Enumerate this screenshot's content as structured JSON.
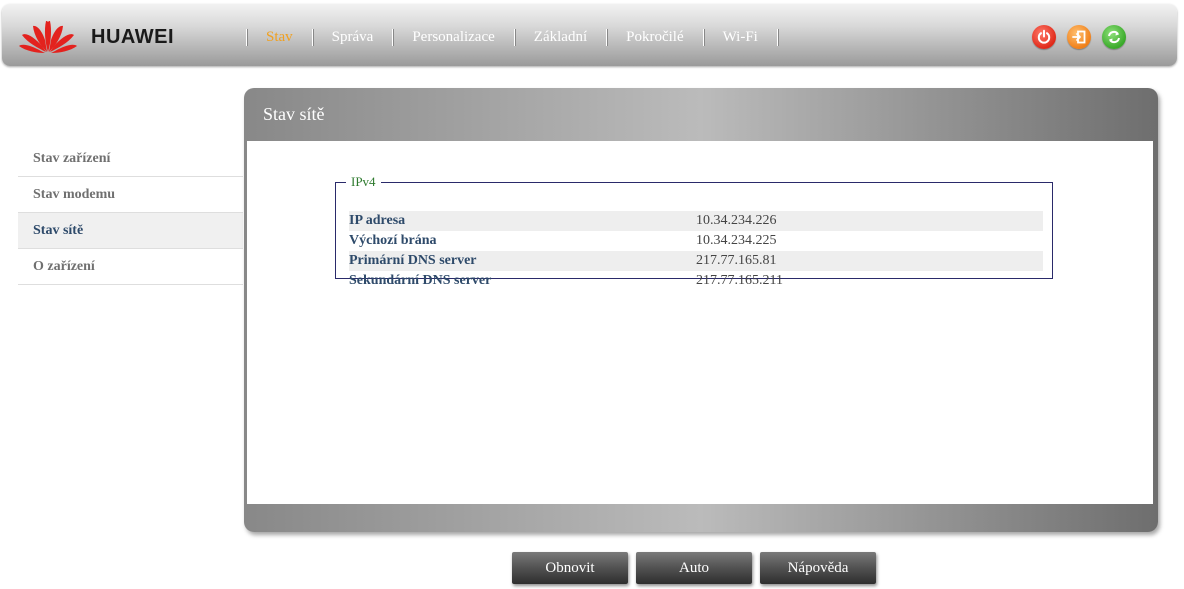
{
  "header": {
    "brand": "HUAWEI",
    "nav": [
      {
        "label": "Stav",
        "active": true
      },
      {
        "label": "Správa"
      },
      {
        "label": "Personalizace"
      },
      {
        "label": "Základní"
      },
      {
        "label": "Pokročilé"
      },
      {
        "label": "Wi-Fi"
      }
    ],
    "icons": [
      "power-icon",
      "logout-icon",
      "refresh-icon"
    ]
  },
  "sidebar": {
    "items": [
      {
        "label": "Stav zařízení"
      },
      {
        "label": "Stav modemu"
      },
      {
        "label": "Stav sítě",
        "active": true
      },
      {
        "label": "O zařízení"
      }
    ]
  },
  "panel": {
    "title": "Stav sítě",
    "section_legend": "IPv4",
    "rows": [
      {
        "label": "IP adresa",
        "value": "10.34.234.226"
      },
      {
        "label": "Výchozí brána",
        "value": "10.34.234.225"
      },
      {
        "label": "Primární DNS server",
        "value": "217.77.165.81"
      },
      {
        "label": "Sekundární DNS server",
        "value": "217.77.165.211"
      }
    ]
  },
  "buttons": {
    "refresh": "Obnovit",
    "auto": "Auto",
    "help": "Nápověda"
  },
  "colors": {
    "nav_active": "#f0a020",
    "label_text": "#2e4a6a",
    "legend_text": "#2e7a2e"
  }
}
